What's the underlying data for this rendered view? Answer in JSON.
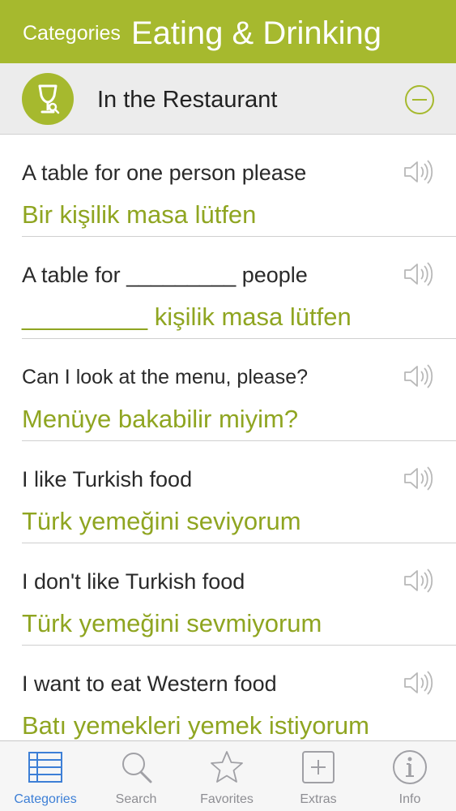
{
  "header": {
    "back_label": "Categories",
    "title": "Eating & Drinking",
    "background_color": "#a6b92e"
  },
  "section": {
    "title": "In the Restaurant",
    "icon": "wine-glass-icon",
    "collapse_icon": "collapse-minus-icon"
  },
  "phrases": [
    {
      "english": "A table for one person please",
      "turkish": "Bir kişilik masa lütfen"
    },
    {
      "english": "A table for _________ people",
      "turkish": "_________ kişilik masa lütfen"
    },
    {
      "english": "Can I look at the menu, please?",
      "turkish": "Menüye bakabilir miyim?"
    },
    {
      "english": "I like Turkish food",
      "turkish": "Türk yemeğini seviyorum"
    },
    {
      "english": "I don't like Turkish food",
      "turkish": "Türk yemeğini sevmiyorum"
    },
    {
      "english": "I want to eat Western food",
      "turkish": "Batı yemekleri yemek istiyorum"
    }
  ],
  "tabs": [
    {
      "label": "Categories",
      "icon": "list-icon",
      "active": true
    },
    {
      "label": "Search",
      "icon": "magnifier-icon",
      "active": false
    },
    {
      "label": "Favorites",
      "icon": "star-icon",
      "active": false
    },
    {
      "label": "Extras",
      "icon": "plus-icon",
      "active": false
    },
    {
      "label": "Info",
      "icon": "info-icon",
      "active": false
    }
  ],
  "colors": {
    "accent": "#a6b92e",
    "translation_text": "#8fa521",
    "active_tab": "#3d7fd6",
    "inactive_tab": "#8e8e93"
  }
}
